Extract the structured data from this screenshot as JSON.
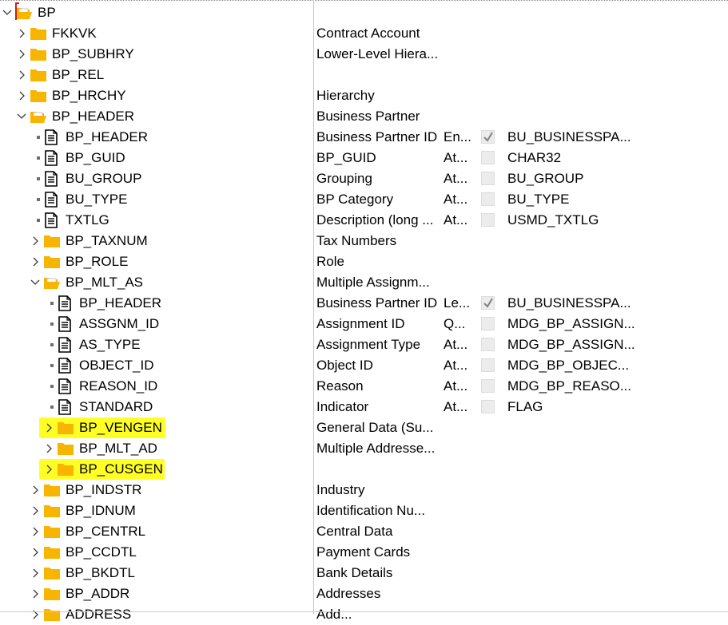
{
  "tree": {
    "rows": [
      {
        "name": "BP",
        "kind": "folder-open",
        "expander": "expanded",
        "description": "",
        "attribute": "",
        "checkbox": null,
        "data_type": "",
        "highlighted": false
      },
      {
        "name": "FKKVK",
        "kind": "folder",
        "expander": "collapsed",
        "description": "Contract Account",
        "attribute": "",
        "checkbox": null,
        "data_type": "",
        "highlighted": false
      },
      {
        "name": "BP_SUBHRY",
        "kind": "folder",
        "expander": "collapsed",
        "description": "Lower-Level Hiera...",
        "attribute": "",
        "checkbox": null,
        "data_type": "",
        "highlighted": false
      },
      {
        "name": "BP_REL",
        "kind": "folder",
        "expander": "collapsed",
        "description": "",
        "attribute": "",
        "checkbox": null,
        "data_type": "",
        "highlighted": false
      },
      {
        "name": "BP_HRCHY",
        "kind": "folder",
        "expander": "collapsed",
        "description": "Hierarchy",
        "attribute": "",
        "checkbox": null,
        "data_type": "",
        "highlighted": false
      },
      {
        "name": "BP_HEADER",
        "kind": "folder-open",
        "expander": "expanded",
        "description": "Business Partner",
        "attribute": "",
        "checkbox": null,
        "data_type": "",
        "highlighted": false
      },
      {
        "name": "BP_HEADER",
        "kind": "doc",
        "expander": "leaf",
        "description": "Business Partner ID",
        "attribute": "En...",
        "checkbox": true,
        "data_type": "BU_BUSINESSPA...",
        "highlighted": false
      },
      {
        "name": "BP_GUID",
        "kind": "doc",
        "expander": "leaf",
        "description": "BP_GUID",
        "attribute": "At...",
        "checkbox": false,
        "data_type": "CHAR32",
        "highlighted": false
      },
      {
        "name": "BU_GROUP",
        "kind": "doc",
        "expander": "leaf",
        "description": "Grouping",
        "attribute": "At...",
        "checkbox": false,
        "data_type": "BU_GROUP",
        "highlighted": false
      },
      {
        "name": "BU_TYPE",
        "kind": "doc",
        "expander": "leaf",
        "description": "BP Category",
        "attribute": "At...",
        "checkbox": false,
        "data_type": "BU_TYPE",
        "highlighted": false
      },
      {
        "name": "TXTLG",
        "kind": "doc",
        "expander": "leaf",
        "description": "Description (long ...",
        "attribute": "At...",
        "checkbox": false,
        "data_type": "USMD_TXTLG",
        "highlighted": false
      },
      {
        "name": "BP_TAXNUM",
        "kind": "folder",
        "expander": "collapsed",
        "description": "Tax Numbers",
        "attribute": "",
        "checkbox": null,
        "data_type": "",
        "highlighted": false
      },
      {
        "name": "BP_ROLE",
        "kind": "folder",
        "expander": "collapsed",
        "description": "Role",
        "attribute": "",
        "checkbox": null,
        "data_type": "",
        "highlighted": false
      },
      {
        "name": "BP_MLT_AS",
        "kind": "folder-open",
        "expander": "expanded",
        "description": "Multiple Assignm...",
        "attribute": "",
        "checkbox": null,
        "data_type": "",
        "highlighted": false
      },
      {
        "name": "BP_HEADER",
        "kind": "doc",
        "expander": "leaf",
        "description": "Business Partner ID",
        "attribute": "Le...",
        "checkbox": true,
        "data_type": "BU_BUSINESSPA...",
        "highlighted": false
      },
      {
        "name": "ASSGNM_ID",
        "kind": "doc",
        "expander": "leaf",
        "description": "Assignment ID",
        "attribute": "Q...",
        "checkbox": false,
        "data_type": "MDG_BP_ASSIGN...",
        "highlighted": false
      },
      {
        "name": "AS_TYPE",
        "kind": "doc",
        "expander": "leaf",
        "description": "Assignment Type",
        "attribute": "At...",
        "checkbox": false,
        "data_type": "MDG_BP_ASSIGN...",
        "highlighted": false
      },
      {
        "name": "OBJECT_ID",
        "kind": "doc",
        "expander": "leaf",
        "description": "Object ID",
        "attribute": "At...",
        "checkbox": false,
        "data_type": "MDG_BP_OBJEC...",
        "highlighted": false
      },
      {
        "name": "REASON_ID",
        "kind": "doc",
        "expander": "leaf",
        "description": "Reason",
        "attribute": "At...",
        "checkbox": false,
        "data_type": "MDG_BP_REASO...",
        "highlighted": false
      },
      {
        "name": "STANDARD",
        "kind": "doc",
        "expander": "leaf",
        "description": "Indicator",
        "attribute": "At...",
        "checkbox": false,
        "data_type": "FLAG",
        "highlighted": false
      },
      {
        "name": "BP_VENGEN",
        "kind": "folder",
        "expander": "collapsed",
        "description": "General Data (Su...",
        "attribute": "",
        "checkbox": null,
        "data_type": "",
        "highlighted": true
      },
      {
        "name": "BP_MLT_AD",
        "kind": "folder",
        "expander": "collapsed",
        "description": "Multiple Addresse...",
        "attribute": "",
        "checkbox": null,
        "data_type": "",
        "highlighted": false
      },
      {
        "name": "BP_CUSGEN",
        "kind": "folder",
        "expander": "collapsed",
        "description": "",
        "attribute": "",
        "checkbox": null,
        "data_type": "",
        "highlighted": true
      },
      {
        "name": "BP_INDSTR",
        "kind": "folder",
        "expander": "collapsed",
        "description": "Industry",
        "attribute": "",
        "checkbox": null,
        "data_type": "",
        "highlighted": false
      },
      {
        "name": "BP_IDNUM",
        "kind": "folder",
        "expander": "collapsed",
        "description": "Identification Nu...",
        "attribute": "",
        "checkbox": null,
        "data_type": "",
        "highlighted": false
      },
      {
        "name": "BP_CENTRL",
        "kind": "folder",
        "expander": "collapsed",
        "description": "Central Data",
        "attribute": "",
        "checkbox": null,
        "data_type": "",
        "highlighted": false
      },
      {
        "name": "BP_CCDTL",
        "kind": "folder",
        "expander": "collapsed",
        "description": "Payment Cards",
        "attribute": "",
        "checkbox": null,
        "data_type": "",
        "highlighted": false
      },
      {
        "name": "BP_BKDTL",
        "kind": "folder",
        "expander": "collapsed",
        "description": "Bank Details",
        "attribute": "",
        "checkbox": null,
        "data_type": "",
        "highlighted": false
      },
      {
        "name": "BP_ADDR",
        "kind": "folder",
        "expander": "collapsed",
        "description": "Addresses",
        "attribute": "",
        "checkbox": null,
        "data_type": "",
        "highlighted": false
      },
      {
        "name": "ADDRESS",
        "kind": "folder",
        "expander": "collapsed",
        "description": "Add...",
        "attribute": "",
        "checkbox": null,
        "data_type": "",
        "highlighted": false
      }
    ]
  },
  "colors": {
    "folder": "#f7b500",
    "highlight": "#ffff26",
    "grid_line": "#c8c8c8",
    "focus_border": "#d21f1f",
    "checkbox_bg": "#ececec",
    "checkmark": "#808080"
  }
}
